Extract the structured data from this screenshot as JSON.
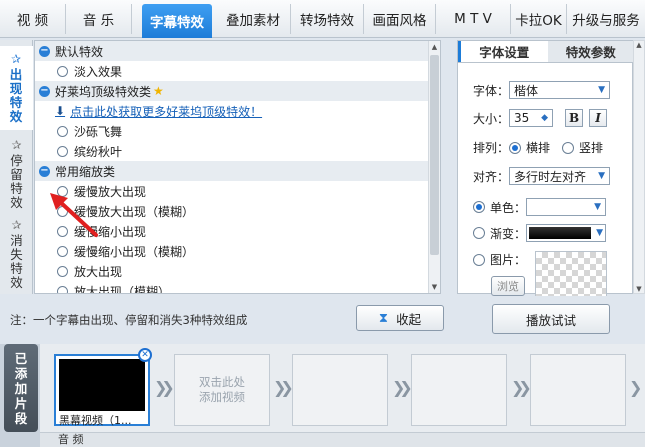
{
  "top_tabs": [
    {
      "label": "视 频"
    },
    {
      "label": "音 乐"
    },
    {
      "label": "字幕特效"
    },
    {
      "label": "叠加素材"
    },
    {
      "label": "转场特效"
    },
    {
      "label": "画面风格"
    },
    {
      "label": "M T V"
    },
    {
      "label": "卡拉OK"
    },
    {
      "label": "升级与服务"
    }
  ],
  "active_top_tab": "字幕特效",
  "left_tabs": [
    {
      "label_lines": [
        "出",
        "现",
        "特",
        "效"
      ]
    },
    {
      "label_lines": [
        "停",
        "留",
        "特",
        "效"
      ]
    },
    {
      "label_lines": [
        "消",
        "失",
        "特",
        "效"
      ]
    }
  ],
  "effect_list": {
    "group_default": "默认特效",
    "default_items": [
      "淡入效果"
    ],
    "group_hollywood": "好莱坞顶级特效类",
    "hollywood_link": "点击此处获取更多好莱坞顶级特效！",
    "hollywood_items": [
      "沙砾飞舞",
      "缤纷秋叶"
    ],
    "group_zoom": "常用缩放类",
    "zoom_items": [
      "缓慢放大出现",
      "缓慢放大出现（模糊）",
      "缓慢缩小出现",
      "缓慢缩小出现（模糊）",
      "放大出现",
      "放大出现（模糊）"
    ]
  },
  "right_panel": {
    "tab_font": "字体设置",
    "tab_effect": "特效参数",
    "font_label": "字体：",
    "font_value": "楷体",
    "size_label": "大小：",
    "size_value": "35",
    "bold_btn": "B",
    "italic_btn": "I",
    "layout_label": "排列：",
    "layout_h": "横排",
    "layout_v": "竖排",
    "align_label": "对齐：",
    "align_value": "多行时左对齐",
    "mono_label": "单色：",
    "gradient_label": "渐变：",
    "image_label": "图片：",
    "browse_btn": "浏览"
  },
  "bottom": {
    "note": "注：一个字幕由出现、停留和消失3种特效组成",
    "collapse_btn": "收起",
    "preview_btn": "播放试试"
  },
  "clips": {
    "label_lines": [
      "已",
      "添",
      "加",
      "片",
      "段"
    ],
    "first_clip_name": "黑幕视频（1...",
    "placeholder_lines": [
      "双击此处",
      "添加视频"
    ],
    "audio_label": "音 频"
  },
  "colors": {
    "accent": "#1d7cd8",
    "arrow": "#e02020"
  }
}
